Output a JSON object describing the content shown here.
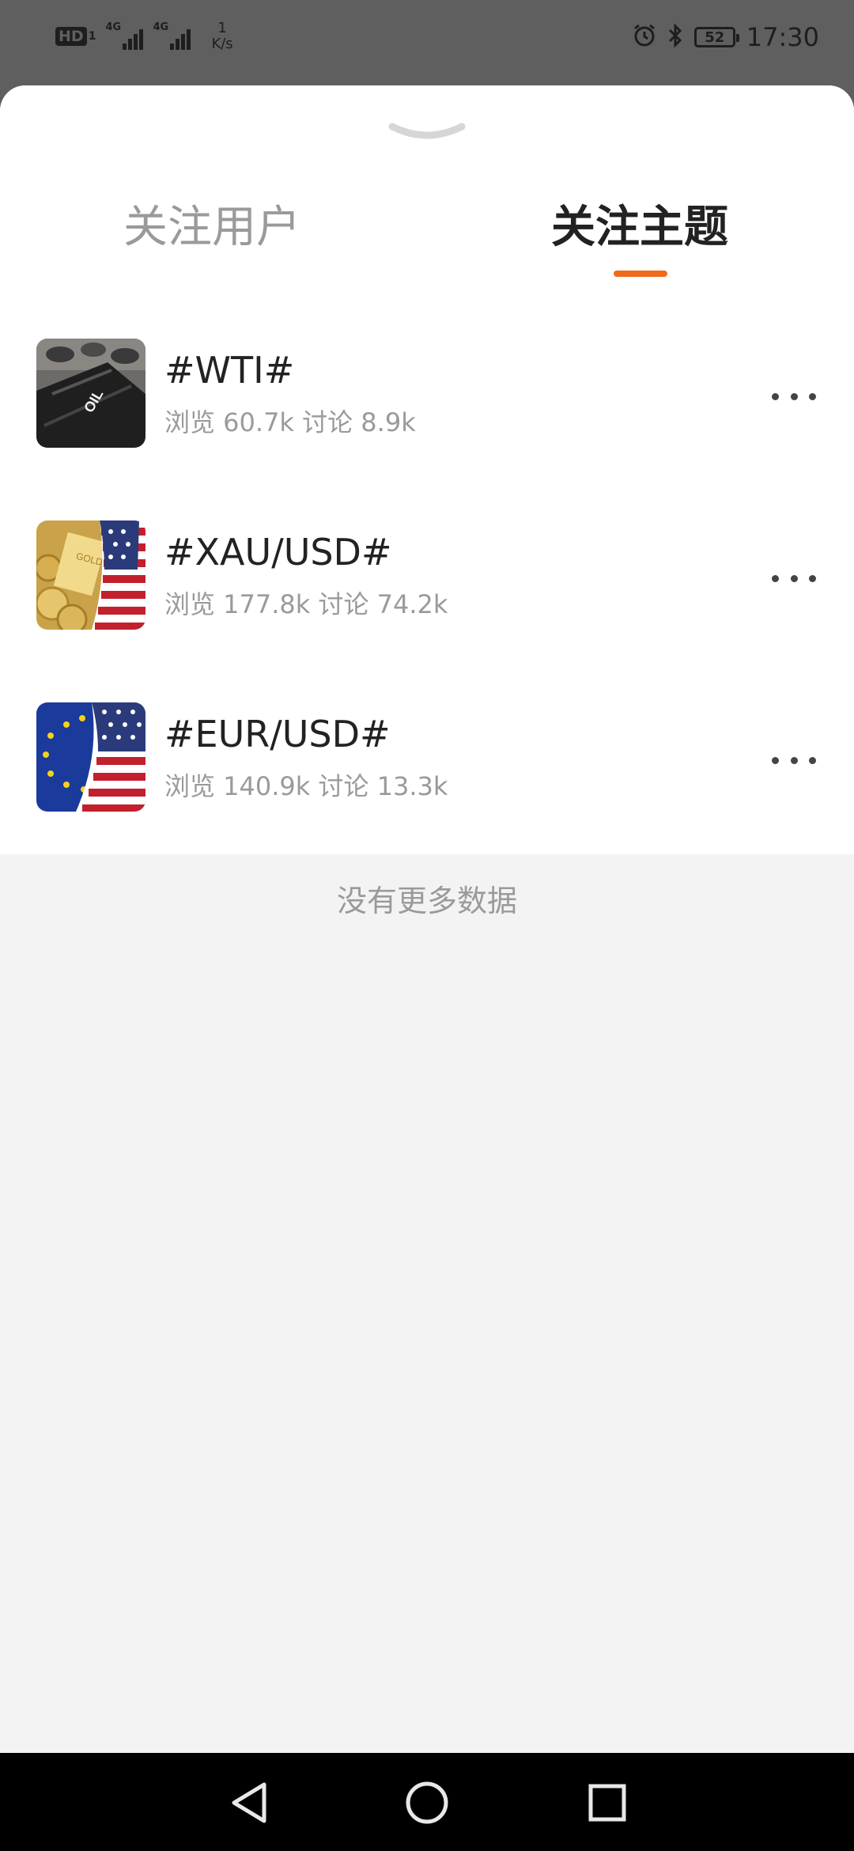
{
  "status_bar": {
    "hd_label": "HD",
    "hd_sub": "1",
    "signal_labels": [
      "4G",
      "4G"
    ],
    "net_speed_value": "1",
    "net_speed_unit": "K/s",
    "battery_level": "52",
    "time": "17:30"
  },
  "tabs": [
    {
      "label": "关注用户",
      "active": false
    },
    {
      "label": "关注主题",
      "active": true
    }
  ],
  "accent_color": "#f26a1b",
  "topics": [
    {
      "title": "#WTI#",
      "stats": "浏览 60.7k 讨论 8.9k",
      "thumb": "oil-barrel",
      "thumb_text": "OIL"
    },
    {
      "title": "#XAU/USD#",
      "stats": "浏览 177.8k 讨论 74.2k",
      "thumb": "gold-us-flag",
      "thumb_text": "GOLD"
    },
    {
      "title": "#EUR/USD#",
      "stats": "浏览 140.9k 讨论 13.3k",
      "thumb": "eu-us-flag"
    }
  ],
  "footer_text": "没有更多数据"
}
